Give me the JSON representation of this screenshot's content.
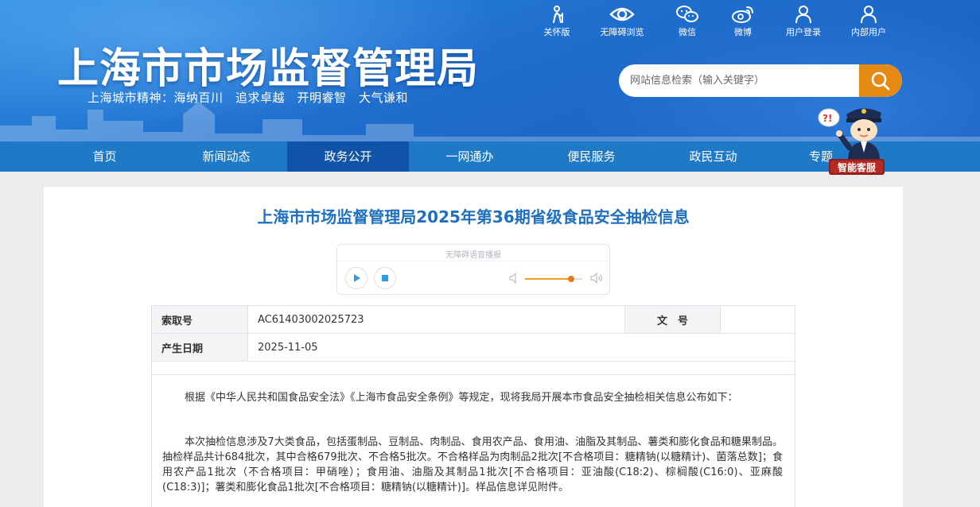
{
  "header": {
    "site_title": "上海市市场监督管理局",
    "motto": "上海城市精神：海纳百川　追求卓越　开明睿智　大气谦和",
    "top_links": [
      {
        "label": "关怀版",
        "icon": "elder-care-icon"
      },
      {
        "label": "无障碍浏览",
        "icon": "eye-icon"
      },
      {
        "label": "微信",
        "icon": "wechat-icon"
      },
      {
        "label": "微博",
        "icon": "weibo-icon"
      },
      {
        "label": "用户登录",
        "icon": "user-icon"
      },
      {
        "label": "内部用户",
        "icon": "internal-user-icon"
      }
    ],
    "search_placeholder": "网站信息检索（输入关键字）"
  },
  "nav": {
    "items": [
      "首页",
      "新闻动态",
      "政务公开",
      "一网通办",
      "便民服务",
      "政民互动",
      "专题"
    ],
    "active_index": 2
  },
  "robot": {
    "label": "智能客服",
    "bubble": "?!"
  },
  "article": {
    "title": "上海市市场监督管理局2025年第36期省级食品安全抽检信息",
    "player": {
      "label": "无障碍语音播报",
      "volume": 0.8
    },
    "meta": {
      "index_label": "索取号",
      "index_value": "AC61403002025723",
      "doc_label": "文　号",
      "doc_value": "",
      "date_label": "产生日期",
      "date_value": "2025-11-05"
    },
    "paragraphs": [
      "根据《中华人民共和国食品安全法》《上海市食品安全条例》等规定，现将我局开展本市食品安全抽检相关信息公布如下：",
      "本次抽检信息涉及7大类食品，包括蛋制品、豆制品、肉制品、食用农产品、食用油、油脂及其制品、薯类和膨化食品和糖果制品。抽检样品共计684批次，其中合格679批次、不合格5批次。不合格样品为肉制品2批次[不合格项目：糖精钠(以糖精计)、菌落总数]；食用农产品1批次（不合格项目：甲硝唑）；食用油、油脂及其制品1批次[不合格项目：亚油酸(C18:2)、棕榈酸(C16:0)、亚麻酸(C18:3)]；薯类和膨化食品1批次[不合格项目：糖精钠(以糖精计)]。样品信息详见附件。"
    ]
  },
  "colors": {
    "header_blue": "#1f6fcf",
    "nav_blue": "#1e79c7",
    "nav_active": "#0f54a8",
    "title_blue": "#1e6fbf",
    "search_orange": "#e58a13"
  }
}
